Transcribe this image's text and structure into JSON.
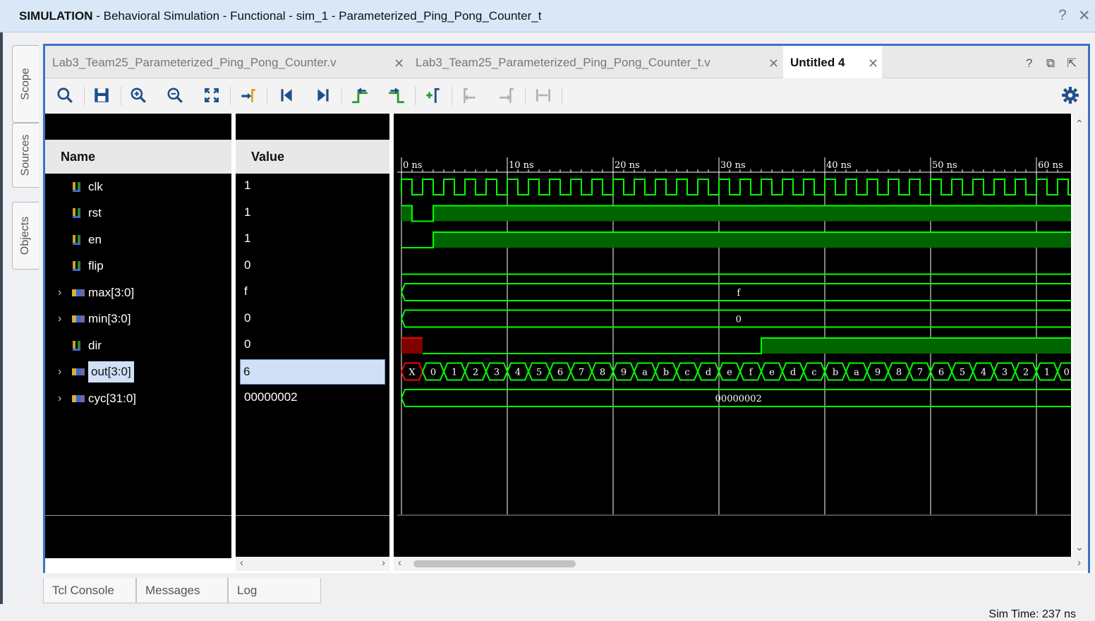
{
  "window": {
    "title_mode": "SIMULATION",
    "title_rest": " - Behavioral Simulation - Functional - sim_1 - Parameterized_Ping_Pong_Counter_t",
    "help": "?",
    "close": "✕"
  },
  "side_tabs": [
    "Scope",
    "Sources",
    "Objects"
  ],
  "tabs": [
    {
      "label": "Lab3_Team25_Parameterized_Ping_Pong_Counter.v",
      "close": "✕"
    },
    {
      "label": "Lab3_Team25_Parameterized_Ping_Pong_Counter_t.v",
      "close": "✕"
    },
    {
      "label": "Untitled 4",
      "close": "✕"
    }
  ],
  "tab_controls": {
    "help": "?",
    "restore": "⧉",
    "float": "⇱"
  },
  "toolbar_icons": [
    "search-icon",
    "save-icon",
    "zoom-in-icon",
    "zoom-out-icon",
    "zoom-fit-icon",
    "go-to-cursor-icon",
    "go-to-start-icon",
    "go-to-end-icon",
    "previous-transition-icon",
    "next-transition-icon",
    "add-marker-icon",
    "previous-marker-icon",
    "next-marker-icon",
    "swap-cursors-icon",
    "settings-icon"
  ],
  "wave": {
    "name_header": "Name",
    "value_header": "Value",
    "signals": [
      {
        "name": "clk",
        "value": "1",
        "icon": "bit-signal-icon",
        "expandable": false
      },
      {
        "name": "rst",
        "value": "1",
        "icon": "bit-signal-icon",
        "expandable": false
      },
      {
        "name": "en",
        "value": "1",
        "icon": "bit-signal-icon",
        "expandable": false
      },
      {
        "name": "flip",
        "value": "0",
        "icon": "bit-signal-icon",
        "expandable": false
      },
      {
        "name": "max[3:0]",
        "value": "f",
        "icon": "bus-signal-icon",
        "expandable": true
      },
      {
        "name": "min[3:0]",
        "value": "0",
        "icon": "bus-signal-icon",
        "expandable": true
      },
      {
        "name": "dir",
        "value": "0",
        "icon": "bit-signal-icon",
        "expandable": false
      },
      {
        "name": "out[3:0]",
        "value": "6",
        "icon": "bus-signal-icon",
        "expandable": true,
        "selected": true
      },
      {
        "name": "cyc[31:0]",
        "value": "00000002",
        "icon": "bus-signal-icon",
        "expandable": true
      }
    ],
    "time_ticks": [
      "0 ns",
      "10 ns",
      "20 ns",
      "30 ns",
      "40 ns",
      "50 ns",
      "60 ns"
    ],
    "max_label": "f",
    "min_label": "0",
    "cyc_label": "00000002",
    "out_values": [
      "X",
      "0",
      "1",
      "2",
      "3",
      "4",
      "5",
      "6",
      "7",
      "8",
      "9",
      "a",
      "b",
      "c",
      "d",
      "e",
      "f",
      "e",
      "d",
      "c",
      "b",
      "a",
      "9",
      "8",
      "7",
      "6",
      "5",
      "4",
      "3",
      "2",
      "1",
      "0"
    ],
    "colors": {
      "trace": "#00ff00",
      "fill": "#006400",
      "unknown": "#ff0000",
      "unknown_fill": "#800000",
      "grid": "#ffffff"
    }
  },
  "bottom_tabs": [
    "Tcl Console",
    "Messages",
    "Log"
  ],
  "status": {
    "sim_time": "Sim Time: 237 ns"
  }
}
